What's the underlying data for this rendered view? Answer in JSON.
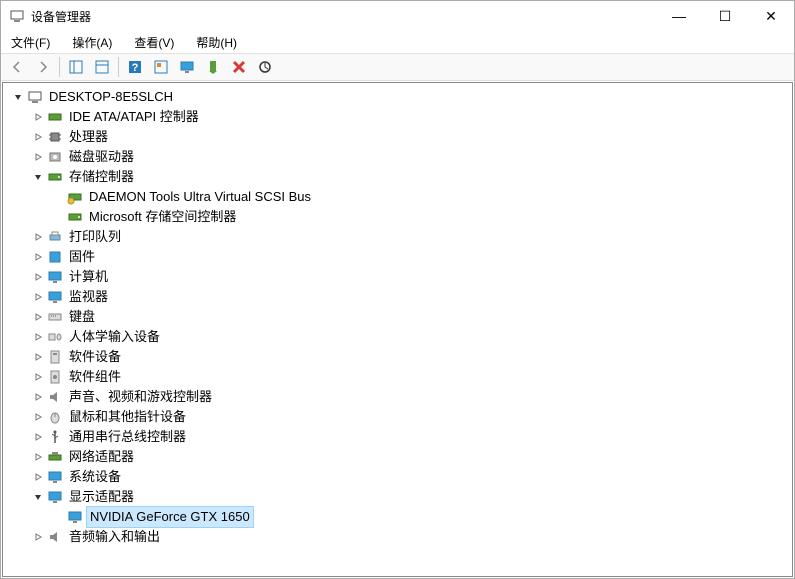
{
  "window": {
    "title": "设备管理器",
    "minimize": "—",
    "maximize": "☐",
    "close": "✕"
  },
  "menu": {
    "file": "文件(F)",
    "action": "操作(A)",
    "view": "查看(V)",
    "help": "帮助(H)"
  },
  "tree": {
    "root": "DESKTOP-8E5SLCH",
    "ide": "IDE ATA/ATAPI 控制器",
    "cpu": "处理器",
    "disk": "磁盘驱动器",
    "storage": "存储控制器",
    "daemon": "DAEMON Tools Ultra Virtual SCSI Bus",
    "msstorage": "Microsoft 存储空间控制器",
    "printqueue": "打印队列",
    "firmware": "固件",
    "computer": "计算机",
    "monitor": "监视器",
    "keyboard": "键盘",
    "hid": "人体学输入设备",
    "swdevice": "软件设备",
    "swcomponent": "软件组件",
    "sound": "声音、视频和游戏控制器",
    "mouse": "鼠标和其他指针设备",
    "usb": "通用串行总线控制器",
    "network": "网络适配器",
    "sysdevice": "系统设备",
    "display": "显示适配器",
    "gpu": "NVIDIA GeForce GTX 1650",
    "audio": "音频输入和输出"
  }
}
